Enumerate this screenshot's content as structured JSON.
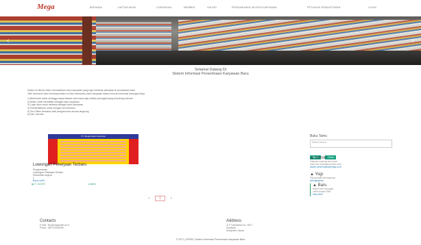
{
  "brand": {
    "logo": "Mega"
  },
  "nav": [
    "BERANDA",
    "DAFTAR AKUN",
    "LOWONGAN",
    "MEMBER",
    "GALERI",
    "PENGUMUMAN SELEKSI KARYAWAN",
    "PETUNJUK PENDAFTARAN",
    "LOGIN"
  ],
  "hero": {
    "prev": "‹",
    "next": "›",
    "slides": 3,
    "active": 1
  },
  "welcome": {
    "line1": "Selamat Datang Di",
    "line2": "Sistem Informasi Penerimaan Karyawan Baru"
  },
  "intro": {
    "p1": "Sistem ini dibuat untuk memudahkan calon karyawan yang ingin melamar pekerjaan di perusahaan kami.",
    "p2": "Oleh karena itu kami berharap sistem ini bisa membantu calon karyawan dalam mencari informasi lowongan kerja.",
    "items": [
      "1) Berbentuk online sehingga dapat diakses dari mana saja melalui perangkat yang terhubung internet",
      "2) Akses untuk mendaftar sebagai calon karyawan",
      "3) Login akun untuk melamar sebagai calon karyawan",
      "4) Pemberitahuan untuk mengisi form lamaran",
      "5) Tes Online bersama hasil pengumuman secara langsung",
      "6) Dan Lain-lain"
    ]
  },
  "job_card": {
    "poster_header": "PT. Mega Retail Indonesia",
    "title": "Lowongan Pekerjaan Terbaru",
    "line1": "Pengumuman",
    "line2": "Lowongan Pekerjaan Terbaru",
    "line3": "Kebutuhan segera",
    "line4": "1",
    "read_more": "Baca Lebih",
    "date": "17 Jul 2017",
    "author": "admin"
  },
  "pager": {
    "prev": "«",
    "current": "1",
    "next": "»"
  },
  "sidebar": {
    "title": "Buku Tamu",
    "search_placeholder": "Search terms...",
    "btn1": "Send",
    "btn2": "Read",
    "admin": {
      "head": "Admin",
      "line1": "Silahkan kunjungi situs kami",
      "line2": "untuk info lowongan terbaru dan",
      "link": "sistem.penerimaan@mega.co.id"
    },
    "yogi": {
      "head": "Yogi",
      "line1": "Terima kasih informasinya",
      "link": "selengkapnya"
    },
    "baru": {
      "head": "Baru",
      "line1": "Mohon info lowongan",
      "line2": "untuk lulusan SMK",
      "link": "baca lebih"
    }
  },
  "footer": {
    "contacts_head": "Contacts",
    "email": "E-Mail : info@megaretail.co.id",
    "phone": "Phone : 0897123456789",
    "address_head": "Address",
    "addr1": "Jl. P. Kalimantan No. 45/17",
    "addr2": "Surakarta",
    "addr3": "Kabupaten Jepara",
    "copyright": "© 2017 | SIPKB | Sistem Informasi Penerimaan Karyawan Baru"
  }
}
